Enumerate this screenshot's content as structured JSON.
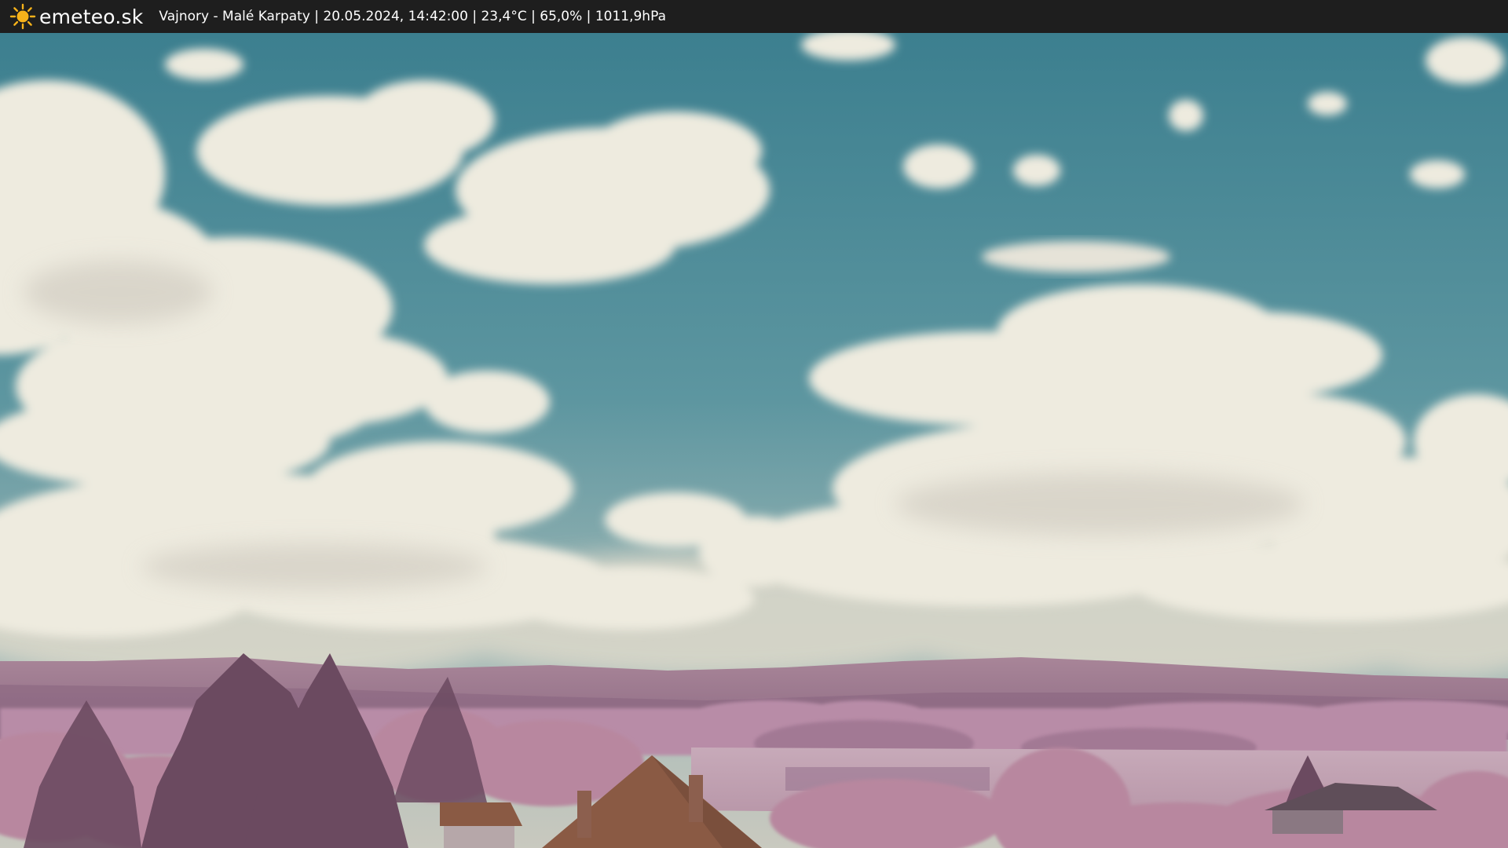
{
  "header": {
    "logo_text": "emeteo.sk",
    "logo_icon": "sun-icon",
    "location": "Vajnory - Malé Karpaty",
    "datetime": "20.05.2024, 14:42:00",
    "temperature": "23,4°C",
    "humidity": "65,0%",
    "pressure": "1011,9hPa",
    "separator": " | "
  },
  "colors": {
    "header_bg": "#1e1e1e",
    "sun": "#f6b21a",
    "sky_top": "#3c7f8f",
    "sky_horizon": "#9fb7b5",
    "cloud": "#eeebdf",
    "hills": "#9f7a92",
    "foliage": "#b98aa6",
    "roof": "#8a5a44"
  }
}
